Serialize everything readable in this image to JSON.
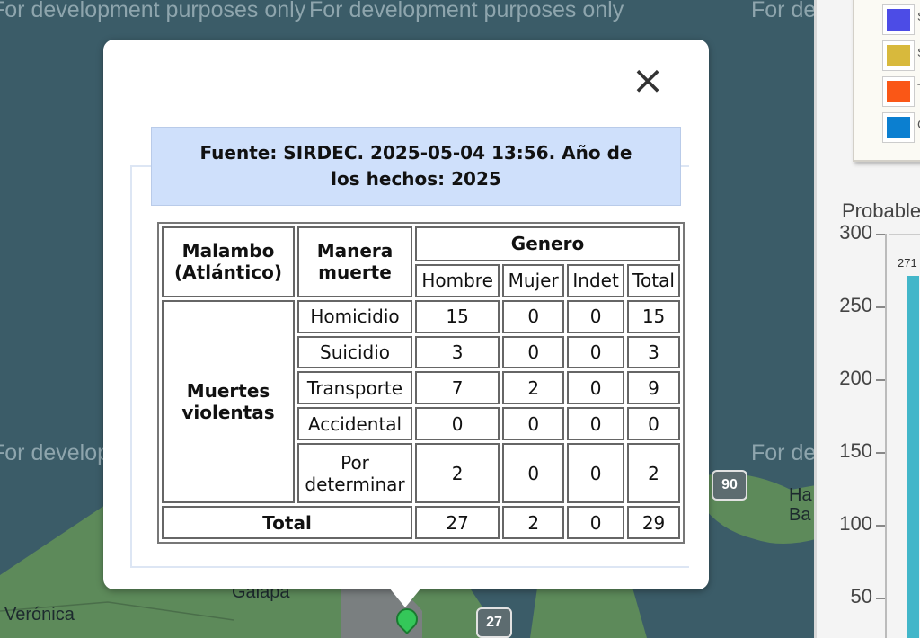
{
  "watermark": "For development purposes only",
  "map": {
    "places": [
      "Verónica",
      "Galapa",
      "Ha",
      "Ba"
    ],
    "routes": [
      "90",
      "27"
    ]
  },
  "right_panel": {
    "legend": [
      {
        "label": "S",
        "color": "#4c4ce6"
      },
      {
        "label": "S",
        "color": "#d8b93c"
      },
      {
        "label": "T",
        "color": "#fa5716"
      },
      {
        "label": "C",
        "color": "#0b7fd0"
      }
    ],
    "chart": {
      "title": "Probable",
      "y_ticks": [
        "300",
        "250",
        "200",
        "150",
        "100",
        "50"
      ]
    }
  },
  "chart_data": {
    "type": "bar",
    "title": "Probable",
    "ylim": [
      0,
      300
    ],
    "values": [
      271
    ],
    "data_labels": [
      "271"
    ],
    "color": "#42b6c9"
  },
  "popup": {
    "close_symbol": "×",
    "source_line1": "Fuente: SIRDEC. 2025-05-04 13:56. Año de",
    "source_line2": "los hechos: 2025",
    "table": {
      "location_line1": "Malambo",
      "location_line2": "(Atlántico)",
      "manner_line1": "Manera",
      "manner_line2": "muerte",
      "gender_header": "Genero",
      "columns": [
        "Hombre",
        "Mujer",
        "Indet",
        "Total"
      ],
      "group_line1": "Muertes",
      "group_line2": "violentas",
      "rows": [
        {
          "label": "Homicidio",
          "values": [
            "15",
            "0",
            "0",
            "15"
          ]
        },
        {
          "label": "Suicidio",
          "values": [
            "3",
            "0",
            "0",
            "3"
          ]
        },
        {
          "label": "Transporte",
          "values": [
            "7",
            "2",
            "0",
            "9"
          ]
        },
        {
          "label": "Accidental",
          "values": [
            "0",
            "0",
            "0",
            "0"
          ]
        }
      ],
      "last_row_line1": "Por",
      "last_row_line2": "determinar",
      "last_row_values": [
        "2",
        "0",
        "0",
        "2"
      ],
      "total_label": "Total",
      "total_values": [
        "27",
        "2",
        "0",
        "29"
      ]
    }
  }
}
